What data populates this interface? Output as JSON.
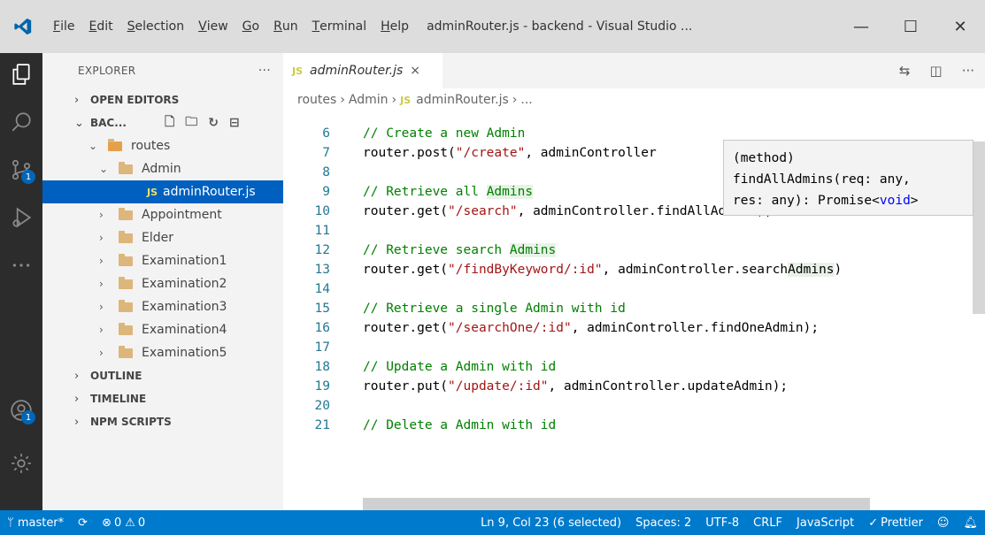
{
  "window": {
    "title": "adminRouter.js - backend - Visual Studio ...",
    "menu": [
      {
        "u": "F",
        "rest": "ile"
      },
      {
        "u": "E",
        "rest": "dit"
      },
      {
        "u": "S",
        "rest": "election"
      },
      {
        "u": "V",
        "rest": "iew"
      },
      {
        "u": "G",
        "rest": "o"
      },
      {
        "u": "R",
        "rest": "un"
      },
      {
        "u": "T",
        "rest": "erminal"
      },
      {
        "u": "H",
        "rest": "elp"
      }
    ],
    "controls": {
      "minimize": "—",
      "maximize": "☐",
      "close": "✕"
    }
  },
  "activity": {
    "scm_badge": "1",
    "accounts_badge": "1"
  },
  "explorer": {
    "header": "EXPLORER",
    "more": "···",
    "sections": {
      "open_editors": "OPEN EDITORS",
      "workspace": "BAC...",
      "outline": "OUTLINE",
      "timeline": "TIMELINE",
      "npm_scripts": "NPM SCRIPTS"
    },
    "tree": {
      "routes": "routes",
      "admin": "Admin",
      "file": "adminRouter.js",
      "js_label": "JS",
      "folders": [
        "Appointment",
        "Elder",
        "Examination1",
        "Examination2",
        "Examination3",
        "Examination4",
        "Examination5"
      ]
    }
  },
  "editor": {
    "tab": {
      "js_label": "JS",
      "title": "adminRouter.js",
      "close": "×"
    },
    "breadcrumb": {
      "a": "routes",
      "b": "Admin",
      "js": "JS",
      "c": "adminRouter.js",
      "d": "..."
    },
    "lines": [
      {
        "n": "6"
      },
      {
        "n": "7"
      },
      {
        "n": "8"
      },
      {
        "n": "9"
      },
      {
        "n": "10"
      },
      {
        "n": "11"
      },
      {
        "n": "12"
      },
      {
        "n": "13"
      },
      {
        "n": "14"
      },
      {
        "n": "15"
      },
      {
        "n": "16"
      },
      {
        "n": "17"
      },
      {
        "n": "18"
      },
      {
        "n": "19"
      },
      {
        "n": "20"
      },
      {
        "n": "21"
      }
    ],
    "code": {
      "l6": "// Create a new Admin",
      "l7a": "router.post(",
      "l7s": "\"/create\"",
      "l7b": ", adminController",
      "l9a": "// Retrieve all ",
      "l9b": "Admins",
      "l10a": "router.get(",
      "l10s": "\"/search\"",
      "l10b": ", adminController.findAllAdmins);",
      "l12a": "// Retrieve search ",
      "l12b": "Admins",
      "l13a": "router.get(",
      "l13s": "\"/findByKeyword/:id\"",
      "l13b": ", adminController.search",
      "l13c": "Admins",
      "l13d": ")",
      "l15": "// Retrieve a single Admin with id",
      "l16a": "router.get(",
      "l16s": "\"/searchOne/:id\"",
      "l16b": ", adminController.findOneAdmin);",
      "l18": "// Update a Admin with id",
      "l19a": "router.put(",
      "l19s": "\"/update/:id\"",
      "l19b": ", adminController.updateAdmin);",
      "l21": "// Delete a Admin with id"
    },
    "tooltip": {
      "l1": "(method)",
      "l2": "findAllAdmins(req: any,",
      "l3a": "res: any): Promise<",
      "l3b": "void",
      "l3c": ">"
    }
  },
  "status": {
    "branch": "master*",
    "errors": "0",
    "warnings": "0",
    "position": "Ln 9, Col 23 (6 selected)",
    "spaces": "Spaces: 2",
    "encoding": "UTF-8",
    "eol": "CRLF",
    "language": "JavaScript",
    "prettier": "Prettier"
  },
  "colors": {
    "statusbar": "#007acc",
    "activitybar": "#2c2c2c",
    "selection": "#0060c0"
  }
}
